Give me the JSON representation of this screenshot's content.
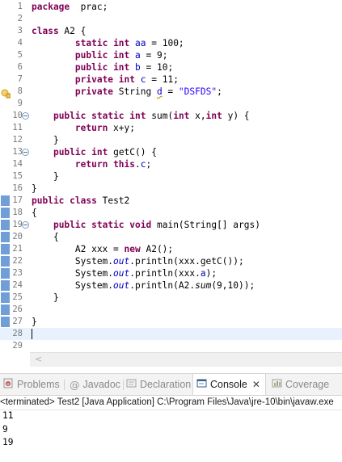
{
  "editor": {
    "lines": [
      {
        "n": "1",
        "segs": [
          [
            "kw",
            "package"
          ],
          [
            "",
            "  prac;"
          ]
        ]
      },
      {
        "n": "2",
        "segs": []
      },
      {
        "n": "3",
        "segs": [
          [
            "kw",
            "class"
          ],
          [
            "",
            " A2 {"
          ]
        ]
      },
      {
        "n": "4",
        "segs": [
          [
            "",
            "        "
          ],
          [
            "kw",
            "static"
          ],
          [
            "",
            " "
          ],
          [
            "kw",
            "int"
          ],
          [
            "",
            " "
          ],
          [
            "fld",
            "aa"
          ],
          [
            "",
            " = 100;"
          ]
        ]
      },
      {
        "n": "5",
        "segs": [
          [
            "",
            "        "
          ],
          [
            "kw",
            "public"
          ],
          [
            "",
            " "
          ],
          [
            "kw",
            "int"
          ],
          [
            "",
            " "
          ],
          [
            "fld",
            "a"
          ],
          [
            "",
            " = 9;"
          ]
        ]
      },
      {
        "n": "6",
        "segs": [
          [
            "",
            "        "
          ],
          [
            "kw",
            "public"
          ],
          [
            "",
            " "
          ],
          [
            "kw",
            "int"
          ],
          [
            "",
            " "
          ],
          [
            "fld",
            "b"
          ],
          [
            "",
            " = 10;"
          ]
        ]
      },
      {
        "n": "7",
        "segs": [
          [
            "",
            "        "
          ],
          [
            "kw",
            "private"
          ],
          [
            "",
            " "
          ],
          [
            "kw",
            "int"
          ],
          [
            "",
            " "
          ],
          [
            "fld",
            "c"
          ],
          [
            "",
            " = 11;"
          ]
        ]
      },
      {
        "n": "8",
        "warn": true,
        "segs": [
          [
            "",
            "        "
          ],
          [
            "kw",
            "private"
          ],
          [
            "",
            " String "
          ],
          [
            "warnfld",
            "d"
          ],
          [
            "",
            " = "
          ],
          [
            "str",
            "\"DSFDS\""
          ],
          [
            "",
            ";"
          ]
        ]
      },
      {
        "n": "9",
        "segs": []
      },
      {
        "n": "10",
        "fold": true,
        "segs": [
          [
            "",
            "    "
          ],
          [
            "kw",
            "public"
          ],
          [
            "",
            " "
          ],
          [
            "kw",
            "static"
          ],
          [
            "",
            " "
          ],
          [
            "kw",
            "int"
          ],
          [
            "",
            " sum("
          ],
          [
            "kw",
            "int"
          ],
          [
            "",
            " x,"
          ],
          [
            "kw",
            "int"
          ],
          [
            "",
            " y) {"
          ]
        ]
      },
      {
        "n": "11",
        "segs": [
          [
            "",
            "        "
          ],
          [
            "kw",
            "return"
          ],
          [
            "",
            " x+y;"
          ]
        ]
      },
      {
        "n": "12",
        "segs": [
          [
            "",
            "    }"
          ]
        ]
      },
      {
        "n": "13",
        "fold": true,
        "segs": [
          [
            "",
            "    "
          ],
          [
            "kw",
            "public"
          ],
          [
            "",
            " "
          ],
          [
            "kw",
            "int"
          ],
          [
            "",
            " getC() {"
          ]
        ]
      },
      {
        "n": "14",
        "segs": [
          [
            "",
            "        "
          ],
          [
            "kw",
            "return"
          ],
          [
            "",
            " "
          ],
          [
            "kw",
            "this"
          ],
          [
            "",
            "."
          ],
          [
            "fld",
            "c"
          ],
          [
            "",
            ";"
          ]
        ]
      },
      {
        "n": "15",
        "segs": [
          [
            "",
            "    }"
          ]
        ]
      },
      {
        "n": "16",
        "segs": [
          [
            "",
            "}"
          ]
        ]
      },
      {
        "n": "17",
        "mark": true,
        "segs": [
          [
            "kw",
            "public"
          ],
          [
            "",
            " "
          ],
          [
            "kw",
            "class"
          ],
          [
            "",
            " Test2"
          ]
        ]
      },
      {
        "n": "18",
        "mark": true,
        "segs": [
          [
            "",
            "{"
          ]
        ]
      },
      {
        "n": "19",
        "mark": true,
        "fold": true,
        "segs": [
          [
            "",
            "    "
          ],
          [
            "kw",
            "public"
          ],
          [
            "",
            " "
          ],
          [
            "kw",
            "static"
          ],
          [
            "",
            " "
          ],
          [
            "kw",
            "void"
          ],
          [
            "",
            " main(String[] args)"
          ]
        ]
      },
      {
        "n": "20",
        "mark": true,
        "segs": [
          [
            "",
            "    {"
          ]
        ]
      },
      {
        "n": "21",
        "mark": true,
        "segs": [
          [
            "",
            "        A2 xxx = "
          ],
          [
            "kw",
            "new"
          ],
          [
            "",
            " A2();"
          ]
        ]
      },
      {
        "n": "22",
        "mark": true,
        "segs": [
          [
            "",
            "        System."
          ],
          [
            "st",
            "out"
          ],
          [
            "",
            ".println(xxx.getC());"
          ]
        ]
      },
      {
        "n": "23",
        "mark": true,
        "segs": [
          [
            "",
            "        System."
          ],
          [
            "st",
            "out"
          ],
          [
            "",
            ".println(xxx."
          ],
          [
            "fld",
            "a"
          ],
          [
            "",
            ");"
          ]
        ]
      },
      {
        "n": "24",
        "mark": true,
        "segs": [
          [
            "",
            "        System."
          ],
          [
            "st",
            "out"
          ],
          [
            "",
            ".println(A2."
          ],
          [
            "stm",
            "sum"
          ],
          [
            "",
            "(9,10));"
          ]
        ]
      },
      {
        "n": "25",
        "mark": true,
        "segs": [
          [
            "",
            "    }"
          ]
        ]
      },
      {
        "n": "26",
        "mark": true,
        "segs": []
      },
      {
        "n": "27",
        "mark": true,
        "segs": [
          [
            "",
            "}"
          ]
        ]
      },
      {
        "n": "28",
        "current": true,
        "segs": []
      },
      {
        "n": "29",
        "segs": []
      }
    ]
  },
  "hscroll": {
    "arrow": "<"
  },
  "tabs": {
    "problems": "Problems",
    "javadoc": "Javadoc",
    "declaration": "Declaration",
    "console": "Console",
    "console_close": "✕",
    "coverage": "Coverage"
  },
  "console": {
    "status": "<terminated> Test2 [Java Application] C:\\Program Files\\Java\\jre-10\\bin\\javaw.exe",
    "output": [
      "11",
      "9",
      "19"
    ]
  },
  "colors": {
    "keyword": "#7f0055",
    "string": "#2a00ff",
    "field": "#0000c0",
    "ruler_mark": "#6f9fd6",
    "current_line": "#e8f2fe"
  }
}
